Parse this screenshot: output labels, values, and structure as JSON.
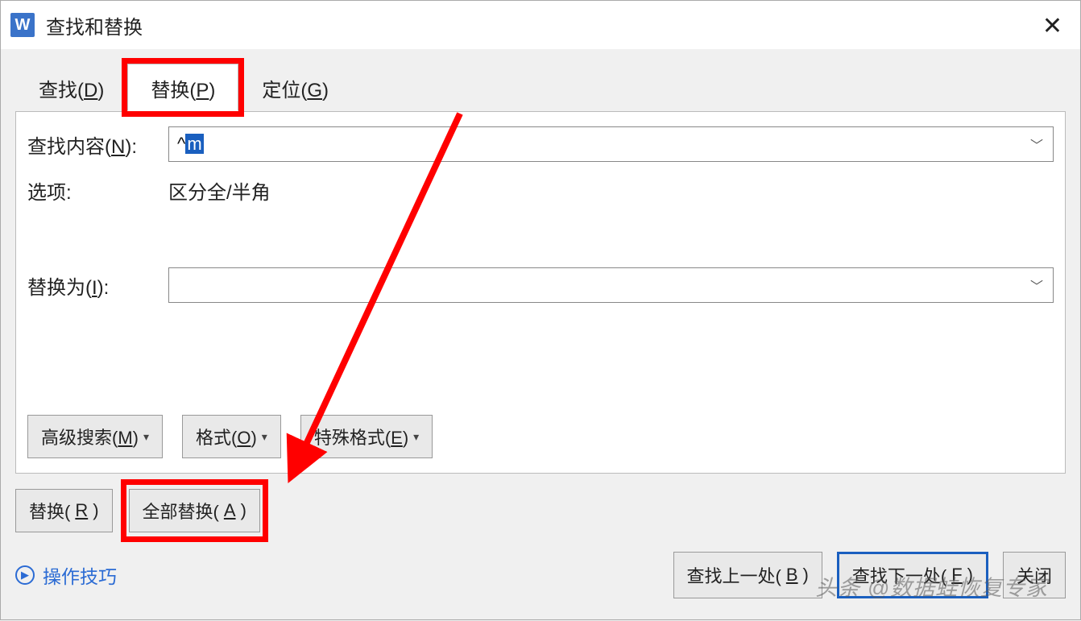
{
  "title": "查找和替换",
  "app_icon_letter": "W",
  "tabs": {
    "find": "查找(D)",
    "replace": "替换(P)",
    "goto": "定位(G)"
  },
  "labels": {
    "find_content": "查找内容(N):",
    "options": "选项:",
    "options_value": "区分全/半角",
    "replace_with": "替换为(I):"
  },
  "find_value_prefix": "^",
  "find_value_selected": "m",
  "replace_value": "",
  "dropdown_buttons": {
    "advanced": "高级搜索(M)",
    "format": "格式(O)",
    "special": "特殊格式(E)"
  },
  "footer_buttons": {
    "replace": "替换(R)",
    "replace_all": "全部替换(A)",
    "find_prev": "查找上一处(B)",
    "find_next": "查找下一处(F)",
    "close": "关闭"
  },
  "tips_label": "操作技巧",
  "watermark": "头条 @数据蛙恢复专家",
  "highlight_color": "#ff0000"
}
